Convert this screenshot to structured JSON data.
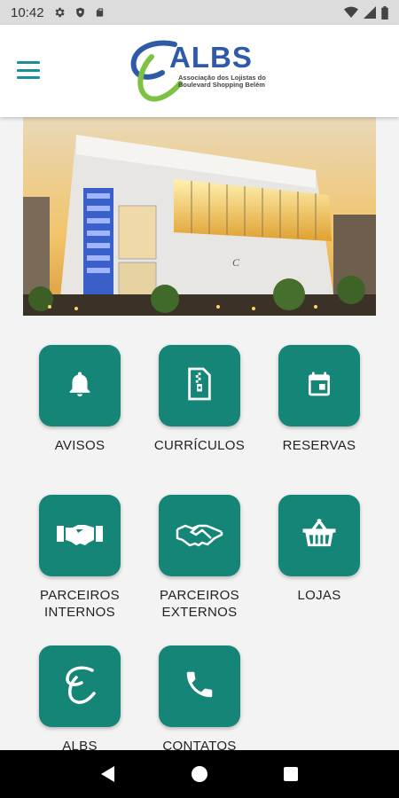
{
  "status_bar": {
    "time": "10:42",
    "icons": [
      "gear-icon",
      "shield-icon",
      "sd-card-icon",
      "wifi-icon",
      "signal-icon",
      "battery-icon"
    ]
  },
  "app_bar": {
    "menu_icon": "hamburger-menu-icon",
    "logo": {
      "title": "ALBS",
      "subtitle_line1": "Associação dos Lojistas do",
      "subtitle_line2": "Boulevard Shopping Belém"
    }
  },
  "banner": {
    "description_icon": "shopping-mall-photo"
  },
  "menu": {
    "accent_color": "#148577",
    "items": [
      {
        "label": "AVISOS",
        "label2": "",
        "icon": "bell-icon"
      },
      {
        "label": "CURRÍCULOS",
        "label2": "",
        "icon": "zip-file-icon"
      },
      {
        "label": "RESERVAS",
        "label2": "",
        "icon": "calendar-icon"
      },
      {
        "label": "PARCEIROS",
        "label2": "INTERNOS",
        "icon": "handshake-icon"
      },
      {
        "label": "PARCEIROS",
        "label2": "EXTERNOS",
        "icon": "handshake-icon"
      },
      {
        "label": "LOJAS",
        "label2": "",
        "icon": "basket-icon"
      },
      {
        "label": "ALBS",
        "label2": "",
        "icon": "albs-logo-icon"
      },
      {
        "label": "CONTATOS",
        "label2": "",
        "icon": "phone-icon"
      }
    ]
  },
  "nav_bar": {
    "icons": [
      "back-icon",
      "home-icon",
      "recents-icon"
    ]
  }
}
